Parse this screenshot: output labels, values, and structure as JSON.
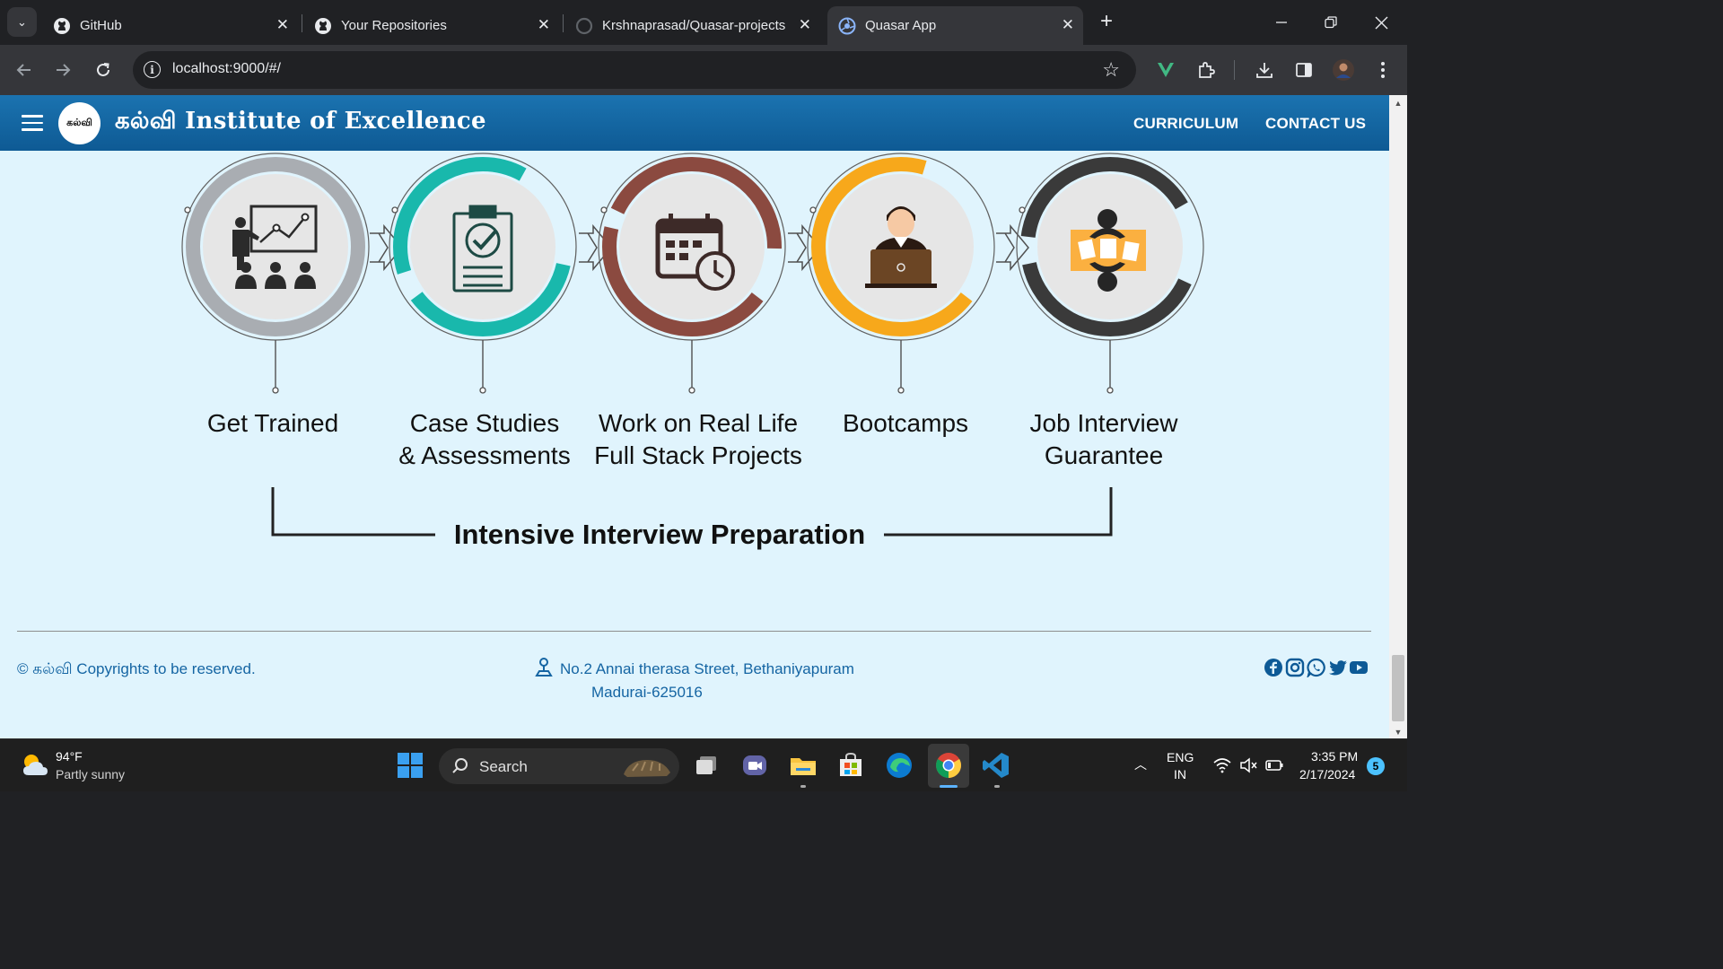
{
  "browser": {
    "tabs": [
      {
        "title": "GitHub",
        "icon": "github-icon"
      },
      {
        "title": "Your Repositories",
        "icon": "github-icon"
      },
      {
        "title": "Krshnaprasad/Quasar-projects",
        "icon": "loading-icon"
      },
      {
        "title": "Quasar App",
        "icon": "quasar-icon",
        "active": true
      }
    ],
    "url": "localhost:9000/#/"
  },
  "app": {
    "logo_text": "கல்வி",
    "title": "கல்வி Institute of Excellence",
    "nav": {
      "curriculum": "CURRICULUM",
      "contact": "CONTACT US"
    }
  },
  "process": {
    "steps": [
      {
        "line1": "Get Trained",
        "line2": "",
        "color": "#a9adb2",
        "icon": "trainer-icon"
      },
      {
        "line1": "Case Studies",
        "line2": "& Assessments",
        "color": "#19b8ac",
        "icon": "checklist-icon"
      },
      {
        "line1": "Work on Real Life",
        "line2": "Full Stack Projects",
        "color": "#8b4a40",
        "icon": "calendar-clock-icon"
      },
      {
        "line1": "Bootcamps",
        "line2": "",
        "color": "#f7a81b",
        "icon": "laptop-user-icon"
      },
      {
        "line1": "Job Interview",
        "line2": "Guarantee",
        "color": "#3a3a3a",
        "icon": "interview-icon"
      }
    ],
    "bracket_title": "Intensive Interview Preparation"
  },
  "footer": {
    "copyright": "© கல்வி Copyrights to be reserved.",
    "address_line1": "No.2 Annai therasa Street, Bethaniyapuram",
    "address_line2": "Madurai-625016",
    "social": [
      "facebook-icon",
      "instagram-icon",
      "whatsapp-icon",
      "twitter-icon",
      "youtube-icon"
    ],
    "link_color": "#1565a3"
  },
  "taskbar": {
    "weather_temp": "94°F",
    "weather_desc": "Partly sunny",
    "search_label": "Search",
    "lang_line1": "ENG",
    "lang_line2": "IN",
    "time": "3:35 PM",
    "date": "2/17/2024",
    "notifications": "5"
  }
}
